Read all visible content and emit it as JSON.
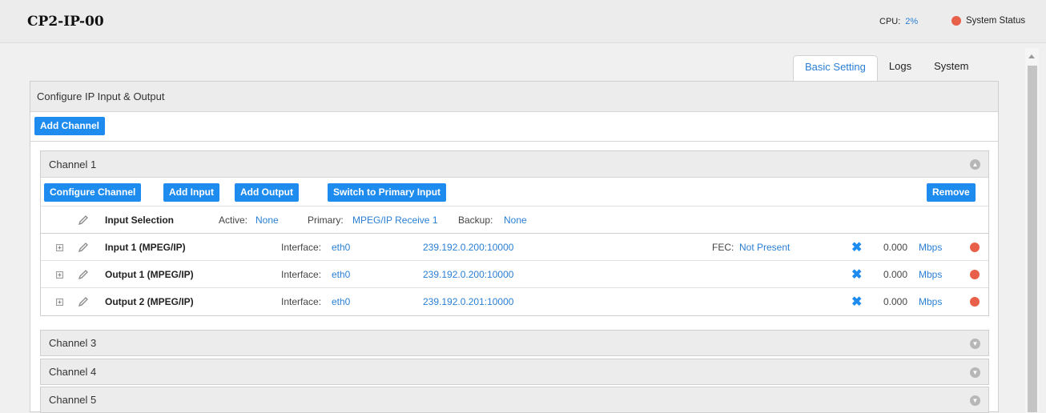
{
  "header": {
    "device_title": "CP2-IP-00",
    "cpu_label": "CPU:",
    "cpu_value": "2%",
    "system_status_label": "System Status",
    "status_color": "#e8604a"
  },
  "tabs": [
    {
      "label": "Basic Setting",
      "active": true
    },
    {
      "label": "Logs",
      "active": false
    },
    {
      "label": "System",
      "active": false
    }
  ],
  "panel": {
    "title": "Configure IP Input & Output",
    "add_channel_label": "Add Channel"
  },
  "channel1": {
    "title": "Channel 1",
    "expanded": true,
    "buttons": {
      "configure": "Configure Channel",
      "add_input": "Add Input",
      "add_output": "Add Output",
      "switch_primary": "Switch to Primary Input",
      "remove": "Remove"
    },
    "input_selection": {
      "label": "Input Selection",
      "active_label": "Active:",
      "active_value": "None",
      "primary_label": "Primary:",
      "primary_value": "MPEG/IP Receive 1",
      "backup_label": "Backup:",
      "backup_value": "None"
    },
    "rows": [
      {
        "name": "Input 1 (MPEG/IP)",
        "interface_label": "Interface:",
        "interface": "eth0",
        "address": "239.192.0.200:10000",
        "fec_label": "FEC:",
        "fec": "Not Present",
        "rate": "0.000",
        "unit": "Mbps"
      },
      {
        "name": "Output 1 (MPEG/IP)",
        "interface_label": "Interface:",
        "interface": "eth0",
        "address": "239.192.0.200:10000",
        "rate": "0.000",
        "unit": "Mbps"
      },
      {
        "name": "Output 2 (MPEG/IP)",
        "interface_label": "Interface:",
        "interface": "eth0",
        "address": "239.192.0.201:10000",
        "rate": "0.000",
        "unit": "Mbps"
      }
    ]
  },
  "collapsed_channels": [
    {
      "title": "Channel 3"
    },
    {
      "title": "Channel 4"
    },
    {
      "title": "Channel 5"
    }
  ],
  "icons": {
    "expand": "plus-box-icon",
    "edit": "pencil-icon",
    "delete": "x-icon",
    "chevron_up": "chevron-up-icon",
    "chevron_down": "chevron-down-icon"
  }
}
